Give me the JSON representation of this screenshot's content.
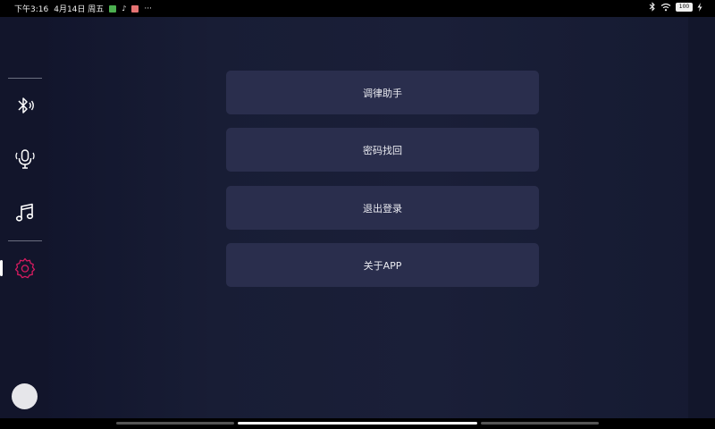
{
  "status_bar": {
    "time": "下午3:16",
    "date": "4月14日 周五",
    "overflow": "···",
    "app_icons": [
      {
        "icon": "green-app-icon",
        "color": "#4caf50"
      },
      {
        "icon": "tiktok-icon",
        "color": "#ffffff"
      },
      {
        "icon": "red-app-icon",
        "color": "#e57373"
      }
    ],
    "battery_level": "100",
    "right_icons": [
      "bluetooth-icon",
      "wifi-icon",
      "battery-icon",
      "charging-icon"
    ]
  },
  "sidebar": {
    "items": [
      {
        "name": "bluetooth",
        "icon": "bluetooth-audio-icon",
        "active": false
      },
      {
        "name": "voice",
        "icon": "microphone-icon",
        "active": false
      },
      {
        "name": "music",
        "icon": "music-note-icon",
        "active": false
      },
      {
        "name": "settings",
        "icon": "gear-icon",
        "active": true
      }
    ],
    "accent_color": "#d81b60",
    "avatar": "avatar"
  },
  "menu": {
    "items": [
      {
        "label": "调律助手"
      },
      {
        "label": "密码找回"
      },
      {
        "label": "退出登录"
      },
      {
        "label": "关于APP"
      }
    ]
  },
  "colors": {
    "background": "#181d35",
    "sidebar": "#12152b",
    "button": "#2a2e4d",
    "text": "#e9eaf0"
  }
}
